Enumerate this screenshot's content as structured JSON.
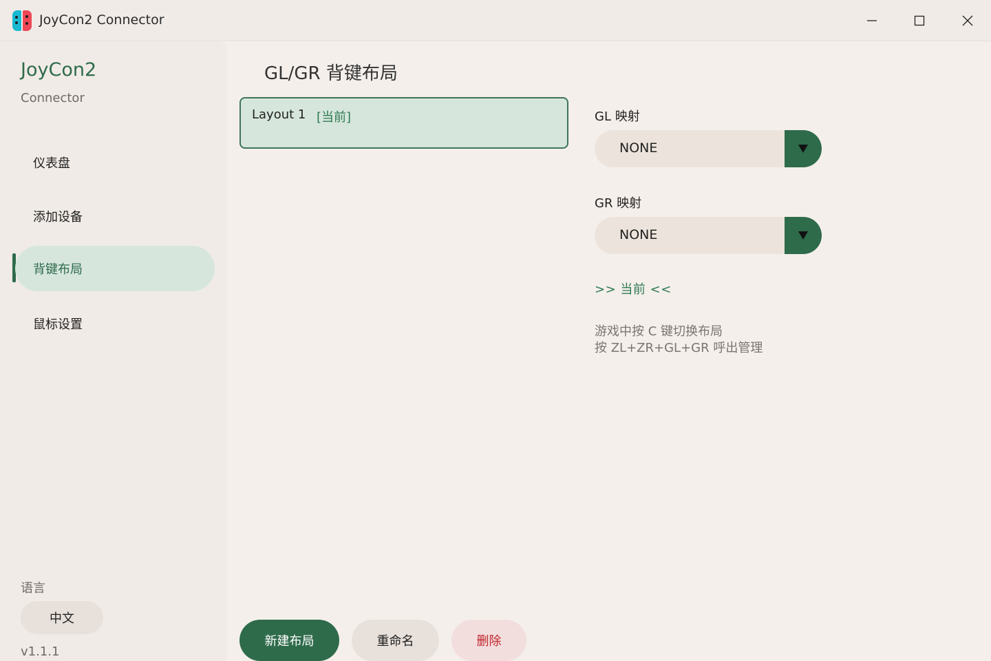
{
  "window": {
    "title": "JoyCon2 Connector"
  },
  "sidebar": {
    "brand_title": "JoyCon2",
    "brand_subtitle": "Connector",
    "items": [
      {
        "label": "仪表盘"
      },
      {
        "label": "添加设备"
      },
      {
        "label": "背键布局",
        "active": true
      },
      {
        "label": "鼠标设置"
      }
    ],
    "language_label": "语言",
    "language_value": "中文",
    "version": "v1.1.1"
  },
  "main": {
    "title": "GL/GR 背键布局",
    "layouts": [
      {
        "name": "Layout 1",
        "tag": "[当前]",
        "selected": true
      }
    ],
    "gl_label": "GL 映射",
    "gl_value": "NONE",
    "gr_label": "GR 映射",
    "gr_value": "NONE",
    "current_marker": ">> 当前 <<",
    "hint_line1": "游戏中按 C 键切换布局",
    "hint_line2": "按 ZL+ZR+GL+GR 呼出管理",
    "buttons": {
      "new": "新建布局",
      "rename": "重命名",
      "delete": "删除"
    }
  },
  "colors": {
    "accent": "#2e6b4b",
    "accent_light": "#d6e6dc",
    "danger": "#c0242c",
    "background": "#f4efeb"
  }
}
